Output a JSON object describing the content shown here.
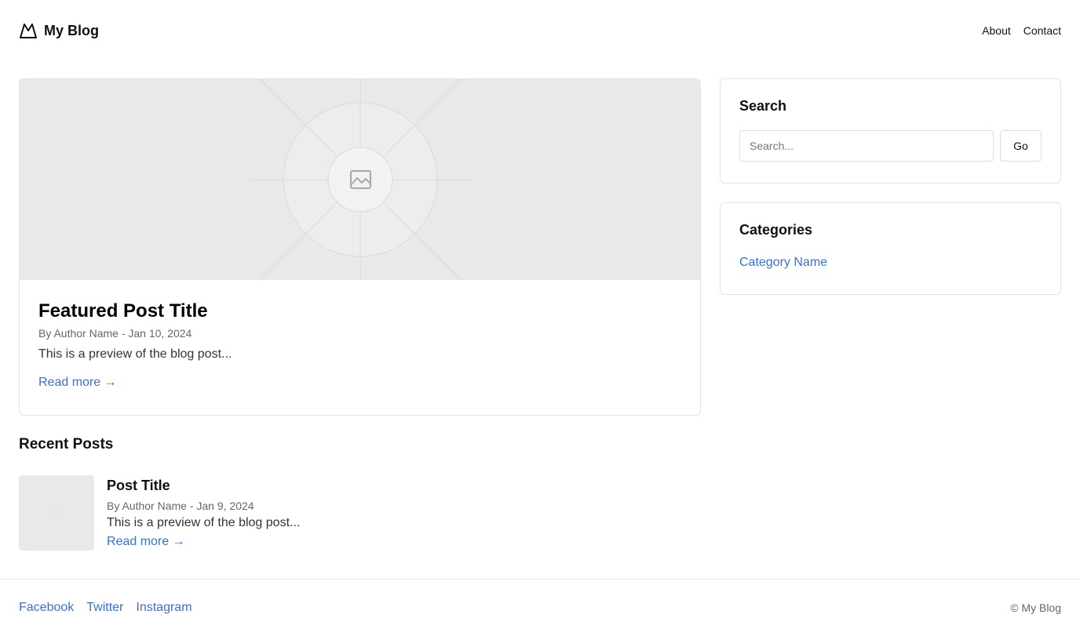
{
  "header": {
    "brand_name": "My Blog",
    "nav": [
      {
        "label": "About"
      },
      {
        "label": "Contact"
      }
    ]
  },
  "featured": {
    "title": "Featured Post Title",
    "meta": "By Author Name - Jan 10, 2024",
    "excerpt": "This is a preview of the blog post...",
    "read_more": "Read more →",
    "image_icon": "image-placeholder-icon"
  },
  "recent": {
    "heading": "Recent Posts",
    "posts": [
      {
        "title": "Post Title",
        "meta": "By Author Name - Jan 9, 2024",
        "excerpt": "This is a preview of the blog post...",
        "read_more": "Read more →"
      }
    ]
  },
  "sidebar": {
    "search": {
      "title": "Search",
      "placeholder": "Search...",
      "value": "",
      "button_label": "Go"
    },
    "categories": {
      "title": "Categories",
      "items": [
        {
          "label": "Category Name"
        }
      ]
    }
  },
  "footer": {
    "social": [
      {
        "label": "Facebook"
      },
      {
        "label": "Twitter"
      },
      {
        "label": "Instagram"
      }
    ],
    "copyright": "© My Blog"
  },
  "colors": {
    "link": "#3a6fd8",
    "border": "#e3e3e3",
    "placeholder_bg": "#e9e9e9"
  }
}
